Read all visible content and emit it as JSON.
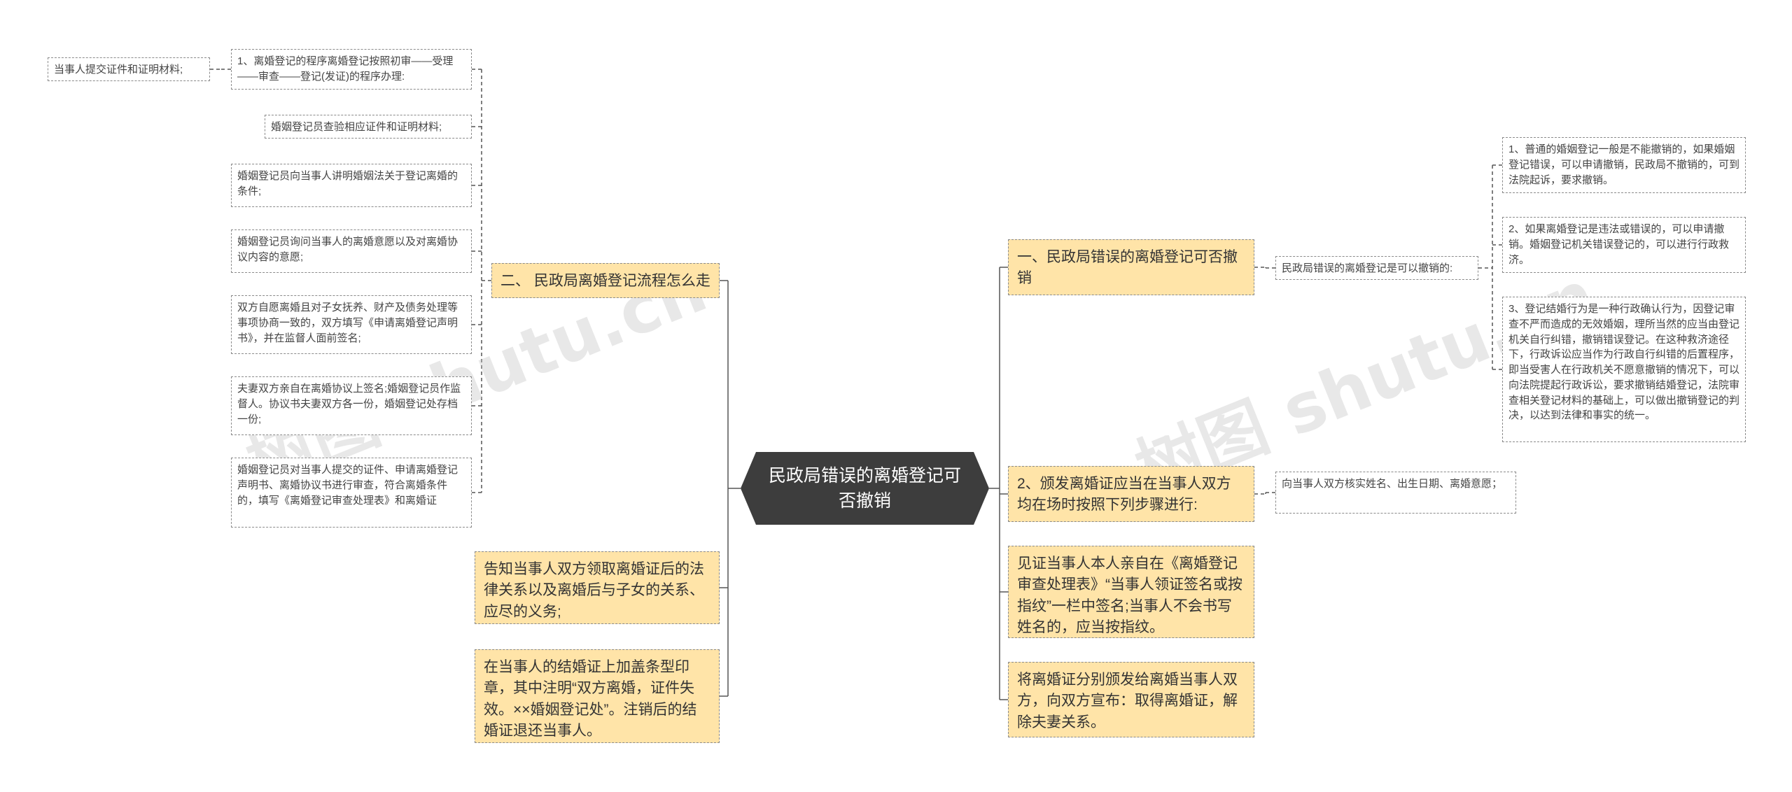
{
  "root": {
    "text": "民政局错误的离婚登记可否撤销"
  },
  "right": {
    "b1": {
      "text": "一、民政局错误的离婚登记可否撤销"
    },
    "b1_child": {
      "text": "民政局错误的离婚登记是可以撤销的:"
    },
    "b1_leaves": [
      "1、普通的婚姻登记一般是不能撤销的，如果婚姻登记错误，可以申请撤销，民政局不撤销的，可到法院起诉，要求撤销。",
      "2、如果离婚登记是违法或错误的，可以申请撤销。婚姻登记机关错误登记的，可以进行行政救济。",
      "3、登记结婚行为是一种行政确认行为，因登记审查不严而造成的无效婚姻，理所当然的应当由登记机关自行纠错，撤销错误登记。在这种救济途径下，行政诉讼应当作为行政自行纠错的后置程序，即当受害人在行政机关不愿意撤销的情况下，可以向法院提起行政诉讼，要求撤销结婚登记，法院审查相关登记材料的基础上，可以做出撤销登记的判决，以达到法律和事实的统一。"
    ],
    "b2": {
      "text": "2、颁发离婚证应当在当事人双方均在场时按照下列步骤进行:"
    },
    "b2_leaf": {
      "text": "向当事人双方核实姓名、出生日期、离婚意愿；"
    },
    "b3": {
      "text": "见证当事人本人亲自在《离婚登记审查处理表》“当事人领证签名或按指纹”一栏中签名;当事人不会书写姓名的，应当按指纹。"
    },
    "b4": {
      "text": "将离婚证分别颁发给离婚当事人双方，向双方宣布：取得离婚证，解除夫妻关系。"
    }
  },
  "left": {
    "b1": {
      "text": "二、 民政局离婚登记流程怎么走"
    },
    "b1_leaves": [
      "1、离婚登记的程序离婚登记按照初审——受理——审查——登记(发证)的程序办理:",
      "婚姻登记员查验相应证件和证明材料;",
      "婚姻登记员向当事人讲明婚姻法关于登记离婚的条件;",
      "婚姻登记员询问当事人的离婚意愿以及对离婚协议内容的意愿;",
      "双方自愿离婚且对子女抚养、财产及债务处理等事项协商一致的，双方填写《申请离婚登记声明书》，并在监督人面前签名;",
      "夫妻双方亲自在离婚协议上签名;婚姻登记员作监督人。协议书夫妻双方各一份，婚姻登记处存档一份;",
      "婚姻登记员对当事人提交的证件、申请离婚登记声明书、离婚协议书进行审查，符合离婚条件的，填写《离婚登记审查处理表》和离婚证"
    ],
    "sub_leaf": {
      "text": "当事人提交证件和证明材料;"
    },
    "b2": {
      "text": "告知当事人双方领取离婚证后的法律关系以及离婚后与子女的关系、应尽的义务;"
    },
    "b3": {
      "text": "在当事人的结婚证上加盖条型印章，其中注明“双方离婚，证件失效。××婚姻登记处”。注销后的结婚证退还当事人。"
    }
  },
  "watermarks": [
    "树图 shutu.cn",
    "树图 shutu.cn"
  ],
  "colors": {
    "root_bg": "#3d3d3d",
    "branch_bg": "#ffe4a8",
    "line": "#555555",
    "border": "#8a8a8a"
  }
}
